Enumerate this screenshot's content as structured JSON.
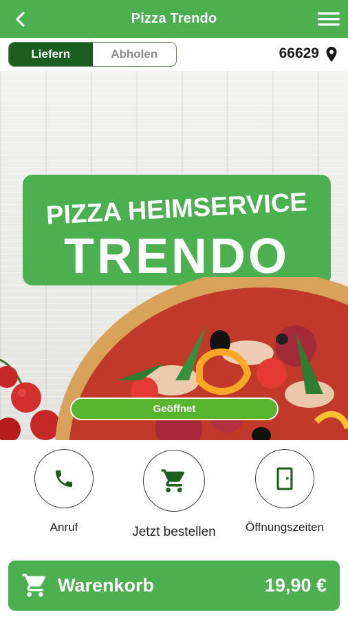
{
  "header": {
    "title": "Pizza Trendo",
    "back_icon": "chevron-left-icon",
    "menu_icon": "hamburger-menu-icon"
  },
  "order_mode": {
    "options": [
      {
        "label": "Liefern",
        "selected": true
      },
      {
        "label": "Abholen",
        "selected": false
      }
    ]
  },
  "location": {
    "zip": "66629",
    "icon": "location-pin-icon"
  },
  "hero": {
    "logo_line1": "PIZZA HEIMSERVICE",
    "logo_line2": "TRENDO",
    "status": "Geöffnet"
  },
  "actions": [
    {
      "label": "Anruf",
      "icon": "phone-icon"
    },
    {
      "label": "Jetzt bestellen",
      "icon": "shopping-cart-icon"
    },
    {
      "label": "Öffnungszeiten",
      "icon": "door-icon"
    }
  ],
  "cart": {
    "label": "Warenkorb",
    "total": "19,90 €",
    "icon": "shopping-cart-icon"
  },
  "colors": {
    "primary": "#4caf50",
    "dark_green": "#1b5e20",
    "status_green": "#57b52f"
  }
}
